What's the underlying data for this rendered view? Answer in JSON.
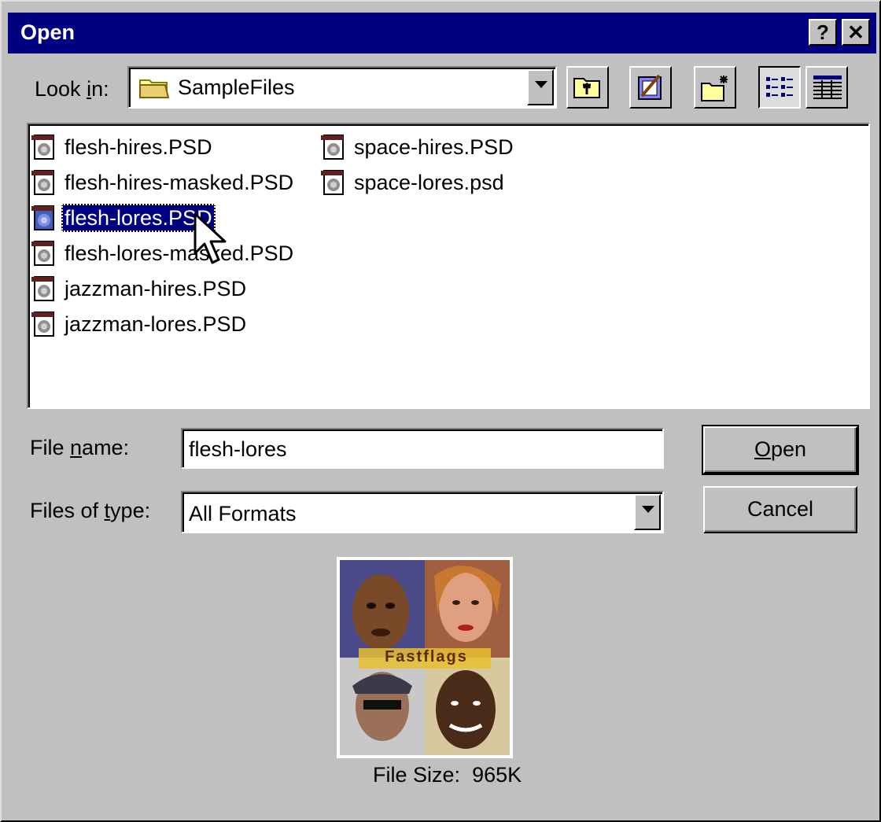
{
  "window": {
    "title": "Open"
  },
  "titlebar_buttons": {
    "help": "?",
    "close": "✕"
  },
  "look_in": {
    "label_pre": "Look ",
    "label_u": "i",
    "label_post": "n:",
    "value": "SampleFiles"
  },
  "toolbar": {
    "up_icon": "up-one-level-icon",
    "web_icon": "look-in-favorites-icon",
    "newfolder_icon": "new-folder-icon",
    "list_icon": "list-view-icon",
    "details_icon": "details-view-icon"
  },
  "files": [
    {
      "name": "flesh-hires.PSD",
      "selected": false
    },
    {
      "name": "flesh-hires-masked.PSD",
      "selected": false
    },
    {
      "name": "flesh-lores.PSD",
      "selected": true
    },
    {
      "name": "flesh-lores-masked.PSD",
      "selected": false
    },
    {
      "name": "jazzman-hires.PSD",
      "selected": false
    },
    {
      "name": "jazzman-lores.PSD",
      "selected": false
    },
    {
      "name": "space-hires.PSD",
      "selected": false
    },
    {
      "name": "space-lores.psd",
      "selected": false
    }
  ],
  "filename": {
    "label_pre": "File ",
    "label_u": "n",
    "label_post": "ame:",
    "value": "flesh-lores"
  },
  "filetype": {
    "label_pre": "Files of ",
    "label_u": "t",
    "label_post": "ype:",
    "value": "All Formats"
  },
  "buttons": {
    "open_u": "O",
    "open_rest": "pen",
    "cancel": "Cancel"
  },
  "preview": {
    "title_text": "Fastflags",
    "size_label": "File Size:",
    "size_value": "965K"
  },
  "colors": {
    "titlebar": "#000080",
    "face": "#c0c0c0",
    "selection": "#000080"
  }
}
